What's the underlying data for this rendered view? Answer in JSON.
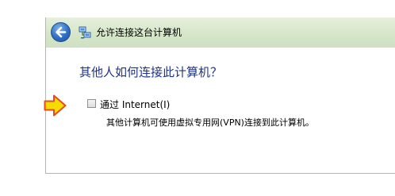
{
  "window": {
    "title": "允许连接这台计算机",
    "back_icon": "back-arrow-icon",
    "app_icon": "network-icon"
  },
  "content": {
    "heading": "其他人如何连接此计算机？",
    "option": {
      "label": "通过 Internet(I)",
      "checked": false,
      "description": "其他计算机可使用虚拟专用网(VPN)连接到此计算机。"
    }
  },
  "annotation": {
    "icon": "yellow-arrow-icon",
    "fill_color": "#f5dc00",
    "stroke_color": "#e84a1c"
  },
  "colors": {
    "heading": "#1e3287",
    "titlebar": "#d6e6c9"
  }
}
